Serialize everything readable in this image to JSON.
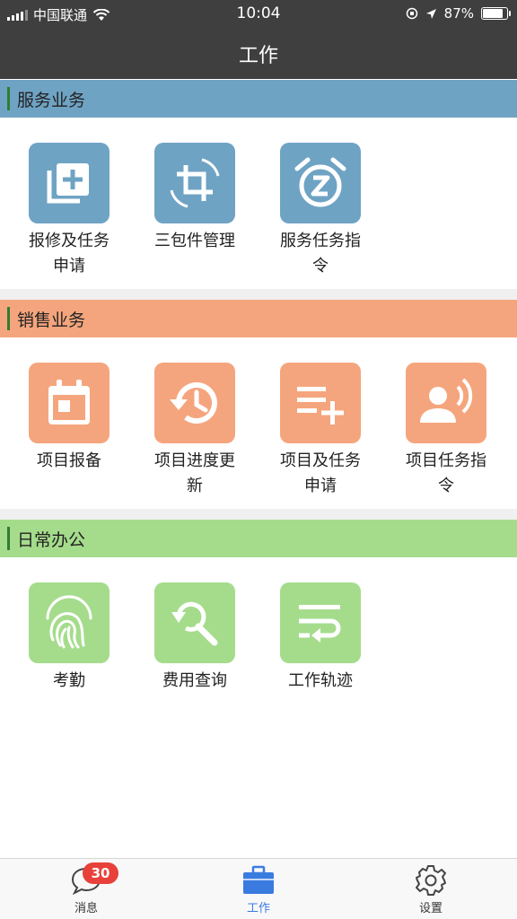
{
  "status_bar": {
    "carrier": "中国联通",
    "time": "10:04",
    "battery_percent": "87%",
    "battery_level": 0.87
  },
  "header": {
    "title": "工作"
  },
  "colors": {
    "header_bg": "#3f3f3f",
    "service": "#6fa3c4",
    "sales": "#f5a57d",
    "office": "#a5dc8c",
    "tab_active": "#3a7be0",
    "badge": "#e8413b"
  },
  "sections": [
    {
      "title": "服务业务",
      "items": [
        {
          "label_lines": [
            "报修及任务",
            "申请"
          ],
          "icon": "add-copy-icon"
        },
        {
          "label_lines": [
            "三包件管理",
            ""
          ],
          "icon": "crop-rotate-icon"
        },
        {
          "label_lines": [
            "服务任务指",
            "令"
          ],
          "icon": "alarm-snooze-icon"
        }
      ]
    },
    {
      "title": "销售业务",
      "items": [
        {
          "label_lines": [
            "项目报备",
            ""
          ],
          "icon": "calendar-icon"
        },
        {
          "label_lines": [
            "项目进度更",
            "新"
          ],
          "icon": "history-icon"
        },
        {
          "label_lines": [
            "项目及任务",
            "申请"
          ],
          "icon": "playlist-add-icon"
        },
        {
          "label_lines": [
            "项目任务指",
            "令"
          ],
          "icon": "record-voice-icon"
        }
      ]
    },
    {
      "title": "日常办公",
      "items": [
        {
          "label_lines": [
            "考勤",
            ""
          ],
          "icon": "fingerprint-icon"
        },
        {
          "label_lines": [
            "费用查询",
            ""
          ],
          "icon": "search-refresh-icon"
        },
        {
          "label_lines": [
            "工作轨迹",
            ""
          ],
          "icon": "wrap-text-icon"
        }
      ]
    }
  ],
  "tabbar": {
    "tabs": [
      {
        "label": "消息",
        "icon": "chat-bubble-icon",
        "badge": "30",
        "active": false
      },
      {
        "label": "工作",
        "icon": "briefcase-icon",
        "active": true
      },
      {
        "label": "设置",
        "icon": "gear-icon",
        "active": false
      }
    ]
  }
}
